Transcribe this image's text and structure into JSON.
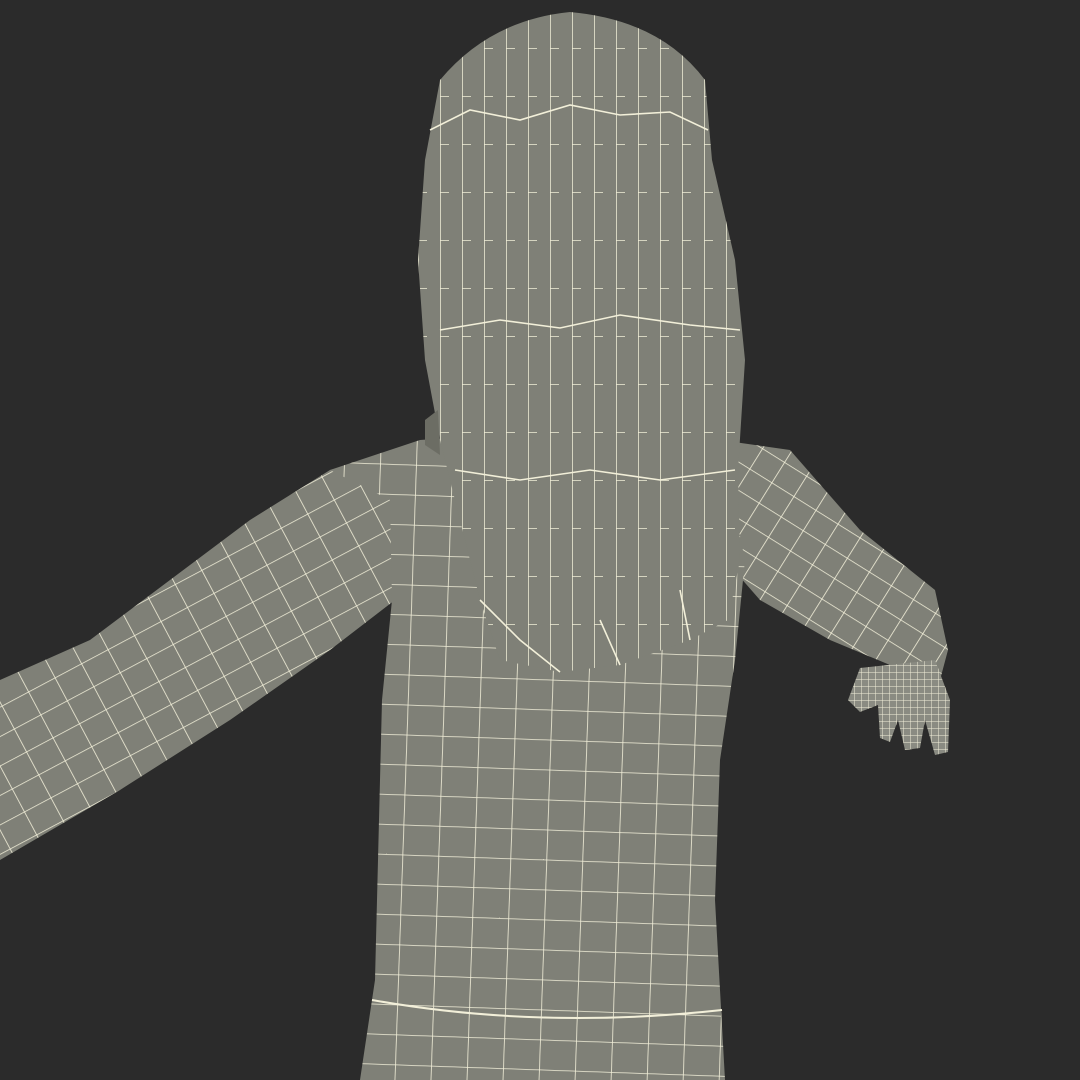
{
  "scene": {
    "subject": "character-model-back-view-wireframe",
    "render_mode": "wireframe-on-shaded",
    "colors": {
      "background": "#2b2b2b",
      "surface": "#7f8077",
      "surface_shadow": "#6c6d64",
      "wire": "#f2efd9"
    }
  }
}
